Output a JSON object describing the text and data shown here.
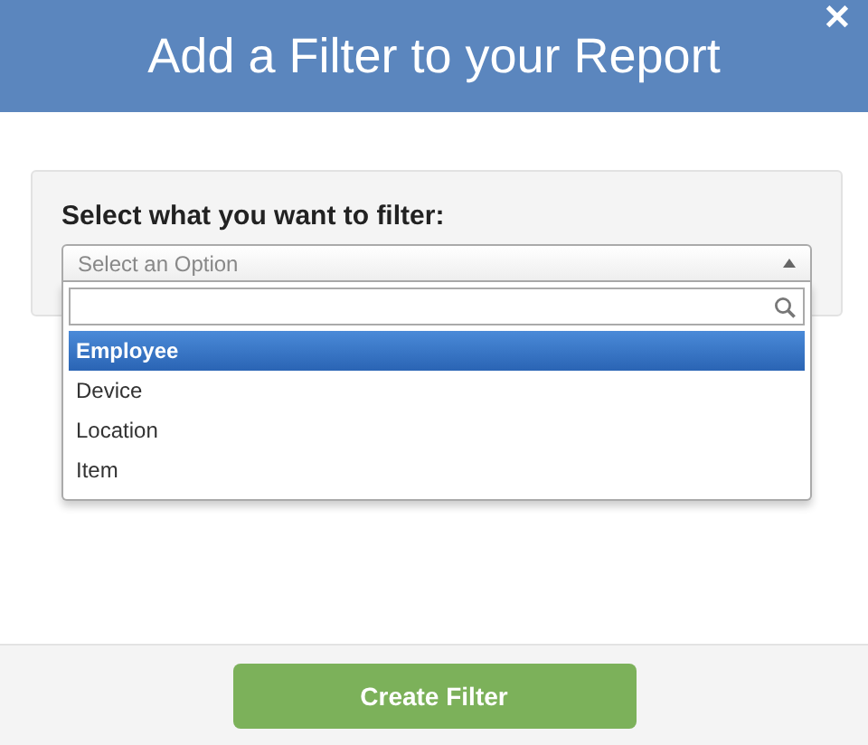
{
  "dialog": {
    "title": "Add a Filter to your Report",
    "close": "✕"
  },
  "field": {
    "label": "Select what you want to filter:",
    "placeholder": "Select an Option",
    "expanded": true
  },
  "dropdown": {
    "options": [
      {
        "label": "Employee",
        "selected": true
      },
      {
        "label": "Device",
        "selected": false
      },
      {
        "label": "Location",
        "selected": false
      },
      {
        "label": "Item",
        "selected": false
      }
    ]
  },
  "buttons": [
    {
      "label": "Create Filter"
    }
  ]
}
